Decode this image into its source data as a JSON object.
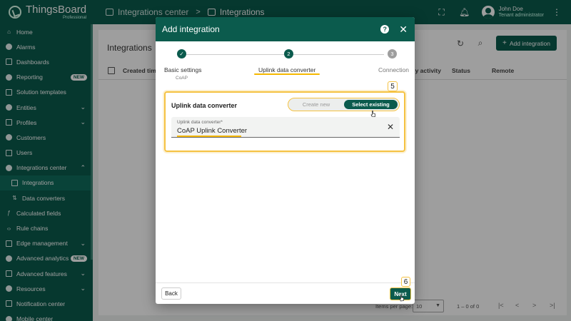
{
  "app": {
    "logo_name": "ThingsBoard",
    "logo_sub": "Professional"
  },
  "topbar": {
    "breadcrumb": [
      "Integrations center",
      "Integrations"
    ],
    "separator": ">",
    "user_name": "John Doe",
    "user_role": "Tenant administrator"
  },
  "sidebar": {
    "items": [
      {
        "label": "Home",
        "icon": "home-icon"
      },
      {
        "label": "Alarms",
        "icon": "bell-icon"
      },
      {
        "label": "Dashboards",
        "icon": "dashboard-icon"
      },
      {
        "label": "Reporting",
        "icon": "report-icon",
        "badge": "NEW"
      },
      {
        "label": "Solution templates",
        "icon": "template-icon"
      },
      {
        "label": "Entities",
        "icon": "entities-icon",
        "chevron": "⌄"
      },
      {
        "label": "Profiles",
        "icon": "profiles-icon",
        "chevron": "⌄"
      },
      {
        "label": "Customers",
        "icon": "customers-icon"
      },
      {
        "label": "Users",
        "icon": "users-icon"
      },
      {
        "label": "Integrations center",
        "icon": "integrations-icon",
        "chevron": "⌃"
      },
      {
        "label": "Integrations",
        "icon": "integration-icon",
        "sub": true,
        "active": true
      },
      {
        "label": "Data converters",
        "icon": "converter-icon",
        "sub": true
      },
      {
        "label": "Calculated fields",
        "icon": "function-icon"
      },
      {
        "label": "Rule chains",
        "icon": "rule-chain-icon"
      },
      {
        "label": "Edge management",
        "icon": "edge-icon",
        "chevron": "⌄"
      },
      {
        "label": "Advanced analytics",
        "icon": "analytics-icon",
        "badge": "NEW"
      },
      {
        "label": "Advanced features",
        "icon": "features-icon",
        "chevron": "⌄"
      },
      {
        "label": "Resources",
        "icon": "folder-icon",
        "chevron": "⌄"
      },
      {
        "label": "Notification center",
        "icon": "notification-icon"
      },
      {
        "label": "Mobile center",
        "icon": "mobile-icon"
      }
    ]
  },
  "page": {
    "title": "Integrations",
    "add_button": "Add integration",
    "columns": [
      "Created time",
      "Daily activity",
      "Status",
      "Remote"
    ],
    "items_per_page_label": "Items per page:",
    "items_per_page": "10",
    "range": "1 – 0 of 0"
  },
  "dialog": {
    "title": "Add integration",
    "steps": [
      {
        "label": "Basic settings",
        "sub": "CoAP",
        "state": "done"
      },
      {
        "label": "Uplink data converter",
        "number": "2",
        "state": "active"
      },
      {
        "label": "Connection",
        "number": "3",
        "state": "todo"
      }
    ],
    "converter_section_label": "Uplink data converter",
    "toggle_create": "Create new",
    "toggle_select": "Select existing",
    "field_label": "Uplink data converter*",
    "field_value": "CoAP Uplink Converter",
    "back_label": "Back",
    "next_label": "Next",
    "callouts": [
      "5",
      "6"
    ]
  },
  "colors": {
    "brand": "#0b5b4d",
    "highlight": "#f5c242"
  }
}
